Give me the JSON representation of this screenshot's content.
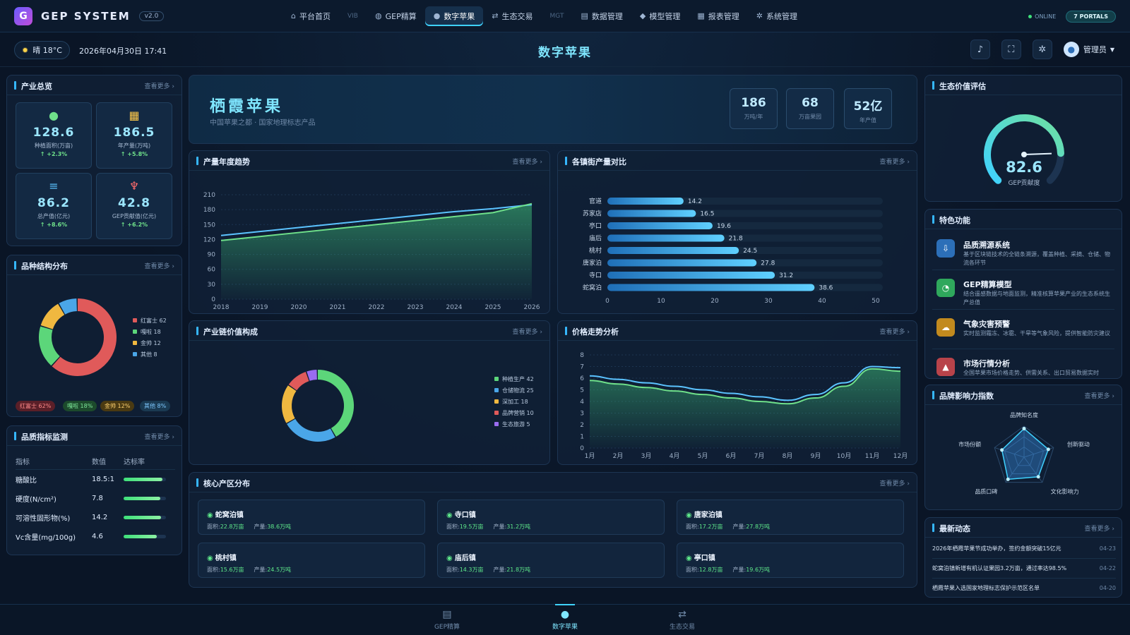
{
  "header": {
    "logo_letter": "G",
    "app_name": "GEP SYSTEM",
    "version": "v2.0",
    "menu": [
      {
        "label": "平台首页",
        "icon": "home-icon",
        "glyph": "⌂"
      },
      {
        "label": "VIB",
        "dim": true
      },
      {
        "label": "GEP精算",
        "icon": "globe-icon",
        "glyph": "◍"
      },
      {
        "label": "数字苹果",
        "icon": "apple-icon",
        "glyph": "●",
        "active": true
      },
      {
        "label": "生态交易",
        "icon": "swap-icon",
        "glyph": "⇄"
      },
      {
        "label": "MGT",
        "dim": true
      },
      {
        "label": "数据管理",
        "icon": "database-icon",
        "glyph": "▤"
      },
      {
        "label": "模型管理",
        "icon": "model-icon",
        "glyph": "◆"
      },
      {
        "label": "报表管理",
        "icon": "report-icon",
        "glyph": "▦"
      },
      {
        "label": "系统管理",
        "icon": "gear-icon",
        "glyph": "✲"
      }
    ],
    "status": "ONLINE",
    "portals": "7 PORTALS"
  },
  "subbar": {
    "weather": "晴 18°C",
    "datetime": "2026年04月30日 17:41",
    "title": "数字苹果",
    "user": "管理员"
  },
  "industry_overview": {
    "title": "产业总览",
    "more": "查看更多 ›",
    "kpis": [
      {
        "value": "128.6",
        "label": "种植面积(万亩)",
        "delta": "↑ +2.3%",
        "icon": "apple-icon",
        "glyph": "●",
        "color": "#6fe08a"
      },
      {
        "value": "186.5",
        "label": "年产量(万吨)",
        "delta": "↑ +5.8%",
        "icon": "boxes-icon",
        "glyph": "▦",
        "color": "#ffc94a"
      },
      {
        "value": "86.2",
        "label": "总产值(亿元)",
        "delta": "↑ +8.6%",
        "icon": "coins-icon",
        "glyph": "≡",
        "color": "#5bc3ff"
      },
      {
        "value": "42.8",
        "label": "GEP贡献值(亿元)",
        "delta": "↑ +6.2%",
        "icon": "sprout-icon",
        "glyph": "♆",
        "color": "#ff6b6b"
      }
    ]
  },
  "variety": {
    "title": "品种结构分布",
    "more": "查看更多 ›",
    "items": [
      {
        "name": "红富士",
        "value": 62,
        "color": "#e05a5a"
      },
      {
        "name": "嘎啦",
        "value": 18,
        "color": "#5cd67a"
      },
      {
        "name": "金帅",
        "value": 12,
        "color": "#f0b840"
      },
      {
        "name": "其他",
        "value": 8,
        "color": "#4aa6e8"
      }
    ],
    "legend_texts": [
      "红富士 62",
      "嘎啦 18",
      "金帅 12",
      "其他 8"
    ],
    "pills": [
      "红富士 62%",
      "嘎啦 18%",
      "金帅 12%",
      "其他 8%"
    ]
  },
  "quality": {
    "title": "品质指标监测",
    "more": "查看更多 ›",
    "headers": [
      "指标",
      "数值",
      "达标率"
    ],
    "rows": [
      {
        "name": "糖酸比",
        "value": "18.5:1",
        "rate": 0.92
      },
      {
        "name": "硬度(N/cm²)",
        "value": "7.8",
        "rate": 0.86
      },
      {
        "name": "可溶性固形物(%)",
        "value": "14.2",
        "rate": 0.88
      },
      {
        "name": "Vc含量(mg/100g)",
        "value": "4.6",
        "rate": 0.78
      }
    ]
  },
  "hero": {
    "title": "栖霞苹果",
    "subtitle": "中国苹果之都 · 国家地理标志产品",
    "stats": [
      {
        "value": "186",
        "label": "万吨/年"
      },
      {
        "value": "68",
        "label": "万亩果园"
      },
      {
        "value": "52亿",
        "label": "年产值"
      }
    ]
  },
  "trend": {
    "title": "产量年度趋势",
    "more": "查看更多 ›",
    "chart_data": {
      "type": "area",
      "x": [
        "2018",
        "2019",
        "2020",
        "2021",
        "2022",
        "2023",
        "2024",
        "2025",
        "2026"
      ],
      "series": [
        {
          "values": [
            128,
            136,
            144,
            152,
            160,
            168,
            176,
            182,
            190
          ],
          "color": "#5bc3ff"
        },
        {
          "values": [
            118,
            126,
            134,
            142,
            150,
            158,
            166,
            174,
            192
          ],
          "color": "#6fe08a"
        }
      ],
      "ylim": [
        0,
        210
      ],
      "yticks": [
        0,
        30,
        60,
        90,
        120,
        150,
        180,
        210
      ]
    }
  },
  "town_output": {
    "title": "各镇街产量对比",
    "more": "查看更多 ›",
    "chart_data": {
      "type": "bar",
      "categories": [
        "官道",
        "苏家店",
        "亭口",
        "庙后",
        "桃村",
        "唐家泊",
        "寺口",
        "蛇窝泊"
      ],
      "values": [
        14.2,
        16.5,
        19.6,
        21.8,
        24.5,
        27.8,
        31.2,
        38.6
      ],
      "xlim": [
        0,
        50
      ],
      "xticks": [
        0,
        10,
        20,
        30,
        40,
        50
      ]
    }
  },
  "value_chain": {
    "title": "产业链价值构成",
    "more": "查看更多 ›",
    "chart_data": {
      "type": "pie",
      "categories": [
        "种植生产",
        "仓储物流",
        "深加工",
        "品牌营销",
        "生态旅游"
      ],
      "values": [
        42,
        25,
        18,
        10,
        5
      ],
      "colors": [
        "#5cd67a",
        "#4aa6e8",
        "#f0b840",
        "#e05a5a",
        "#9a6cf0"
      ]
    },
    "legend_texts": [
      "种植生产 42",
      "仓储物流 25",
      "深加工 18",
      "品牌营销 10",
      "生态旅游 5"
    ]
  },
  "price": {
    "title": "价格走势分析",
    "more": "查看更多 ›",
    "chart_data": {
      "type": "line",
      "x": [
        "1月",
        "2月",
        "3月",
        "4月",
        "5月",
        "6月",
        "7月",
        "8月",
        "9月",
        "10月",
        "11月",
        "12月"
      ],
      "series": [
        {
          "values": [
            6.2,
            5.9,
            5.6,
            5.3,
            5.0,
            4.7,
            4.4,
            4.1,
            4.6,
            5.6,
            7.0,
            6.9
          ],
          "color": "#5bc3ff"
        },
        {
          "values": [
            5.8,
            5.5,
            5.2,
            4.9,
            4.6,
            4.3,
            4.0,
            3.8,
            4.3,
            5.3,
            6.8,
            6.6
          ],
          "color": "#6fe08a"
        }
      ],
      "ylim": [
        0,
        8
      ],
      "yticks": [
        0,
        1,
        2,
        3,
        4,
        5,
        6,
        7,
        8
      ]
    }
  },
  "zones": {
    "title": "核心产区分布",
    "more": "查看更多 ›",
    "items": [
      {
        "name": "蛇窝泊镇",
        "detail": [
          "面积:",
          "22.8万亩",
          "产量:",
          "38.6万吨"
        ]
      },
      {
        "name": "寺口镇",
        "detail": [
          "面积:",
          "19.5万亩",
          "产量:",
          "31.2万吨"
        ]
      },
      {
        "name": "唐家泊镇",
        "detail": [
          "面积:",
          "17.2万亩",
          "产量:",
          "27.8万吨"
        ]
      },
      {
        "name": "桃村镇",
        "detail": [
          "面积:",
          "15.6万亩",
          "产量:",
          "24.5万吨"
        ]
      },
      {
        "name": "庙后镇",
        "detail": [
          "面积:",
          "14.3万亩",
          "产量:",
          "21.8万吨"
        ]
      },
      {
        "name": "亭口镇",
        "detail": [
          "面积:",
          "12.8万亩",
          "产量:",
          "19.6万吨"
        ]
      }
    ]
  },
  "gep_eval": {
    "title": "生态价值评估",
    "value": "82.6",
    "label": "GEP贡献度",
    "fraction": 0.826
  },
  "features": {
    "title": "特色功能",
    "items": [
      {
        "title": "品质溯源系统",
        "desc": "基于区块链技术的全链条溯源，覆盖种植、采摘、仓储、物流各环节",
        "icon": "trace-icon",
        "glyph": "⇩",
        "color": "#2c6fb8"
      },
      {
        "title": "GEP精算模型",
        "desc": "结合遥感数据与地面监测，精准核算苹果产业的生态系统生产总值",
        "icon": "pie-icon",
        "glyph": "◔",
        "color": "#2fa85c"
      },
      {
        "title": "气象灾害预警",
        "desc": "实时监测霜冻、冰雹、干旱等气象风险，提供智能防灾建议",
        "icon": "cloud-icon",
        "glyph": "☁",
        "color": "#c28a1e"
      },
      {
        "title": "市场行情分析",
        "desc": "全国苹果市场价格走势、供需关系、出口贸易数据实时",
        "icon": "market-icon",
        "glyph": "▲",
        "color": "#b8434a"
      }
    ]
  },
  "brand": {
    "title": "品牌影响力指数",
    "more": "查看更多 ›",
    "axes": [
      "品牌知名度",
      "创新驱动",
      "文化影响力",
      "品质口碑",
      "市场份额"
    ],
    "values": [
      0.92,
      0.82,
      0.78,
      0.88,
      0.75
    ]
  },
  "news": {
    "title": "最新动态",
    "more": "查看更多 ›",
    "items": [
      {
        "text": "2026年栖霞苹果节成功举办，签约金额突破15亿元",
        "date": "04-23"
      },
      {
        "text": "蛇窝泊镇新增有机认证果园3.2万亩，通过率达98.5%",
        "date": "04-22"
      },
      {
        "text": "栖霞苹果入选国家地理标志保护示范区名单",
        "date": "04-20"
      }
    ]
  },
  "bottomnav": [
    {
      "label": "GEP精算",
      "icon": "calculator-icon",
      "glyph": "▤"
    },
    {
      "label": "数字苹果",
      "icon": "apple-icon",
      "glyph": "●",
      "active": true
    },
    {
      "label": "生态交易",
      "icon": "swap-icon",
      "glyph": "⇄"
    }
  ]
}
